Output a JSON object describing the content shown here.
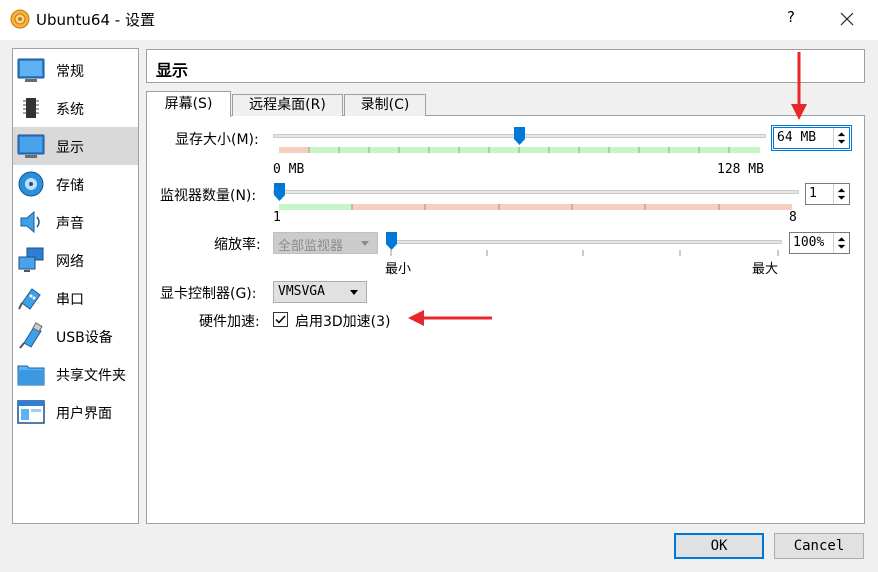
{
  "window": {
    "title": "Ubuntu64 - 设置",
    "help_label": "?"
  },
  "sidebar": {
    "items": [
      {
        "label": "常规",
        "icon": "general-icon"
      },
      {
        "label": "系统",
        "icon": "system-icon"
      },
      {
        "label": "显示",
        "icon": "display-icon",
        "selected": true
      },
      {
        "label": "存储",
        "icon": "storage-icon"
      },
      {
        "label": "声音",
        "icon": "audio-icon"
      },
      {
        "label": "网络",
        "icon": "network-icon"
      },
      {
        "label": "串口",
        "icon": "serial-port-icon"
      },
      {
        "label": "USB设备",
        "icon": "usb-icon"
      },
      {
        "label": "共享文件夹",
        "icon": "shared-folder-icon"
      },
      {
        "label": "用户界面",
        "icon": "user-interface-icon"
      }
    ]
  },
  "section": {
    "title": "显示"
  },
  "tabs": [
    {
      "label": "屏幕(S)",
      "active": true
    },
    {
      "label": "远程桌面(R)",
      "active": false
    },
    {
      "label": "录制(C)",
      "active": false
    }
  ],
  "screen": {
    "video_memory": {
      "label": "显存大小(M):",
      "value": "64 MB",
      "min_label": "0 MB",
      "max_label": "128 MB",
      "min": 0,
      "max": 128,
      "current": 64
    },
    "monitor_count": {
      "label": "监视器数量(N):",
      "value": "1",
      "min_label": "1",
      "max_label": "8",
      "min": 1,
      "max": 8,
      "current": 1
    },
    "scale_factor": {
      "label": "缩放率:",
      "monitor_select": "全部监视器",
      "value": "100%",
      "min_label": "最小",
      "max_label": "最大",
      "position": 0.0
    },
    "graphics_controller": {
      "label": "显卡控制器(G):",
      "value": "VMSVGA"
    },
    "acceleration": {
      "label": "硬件加速:",
      "checkbox_label": "启用3D加速(3)",
      "checked": true
    }
  },
  "buttons": {
    "ok": "OK",
    "cancel": "Cancel"
  },
  "colors": {
    "accent": "#0078d7",
    "band_green": "#c8f5c8",
    "band_red": "#f7cfc0",
    "annotation_red": "#e8262b"
  }
}
